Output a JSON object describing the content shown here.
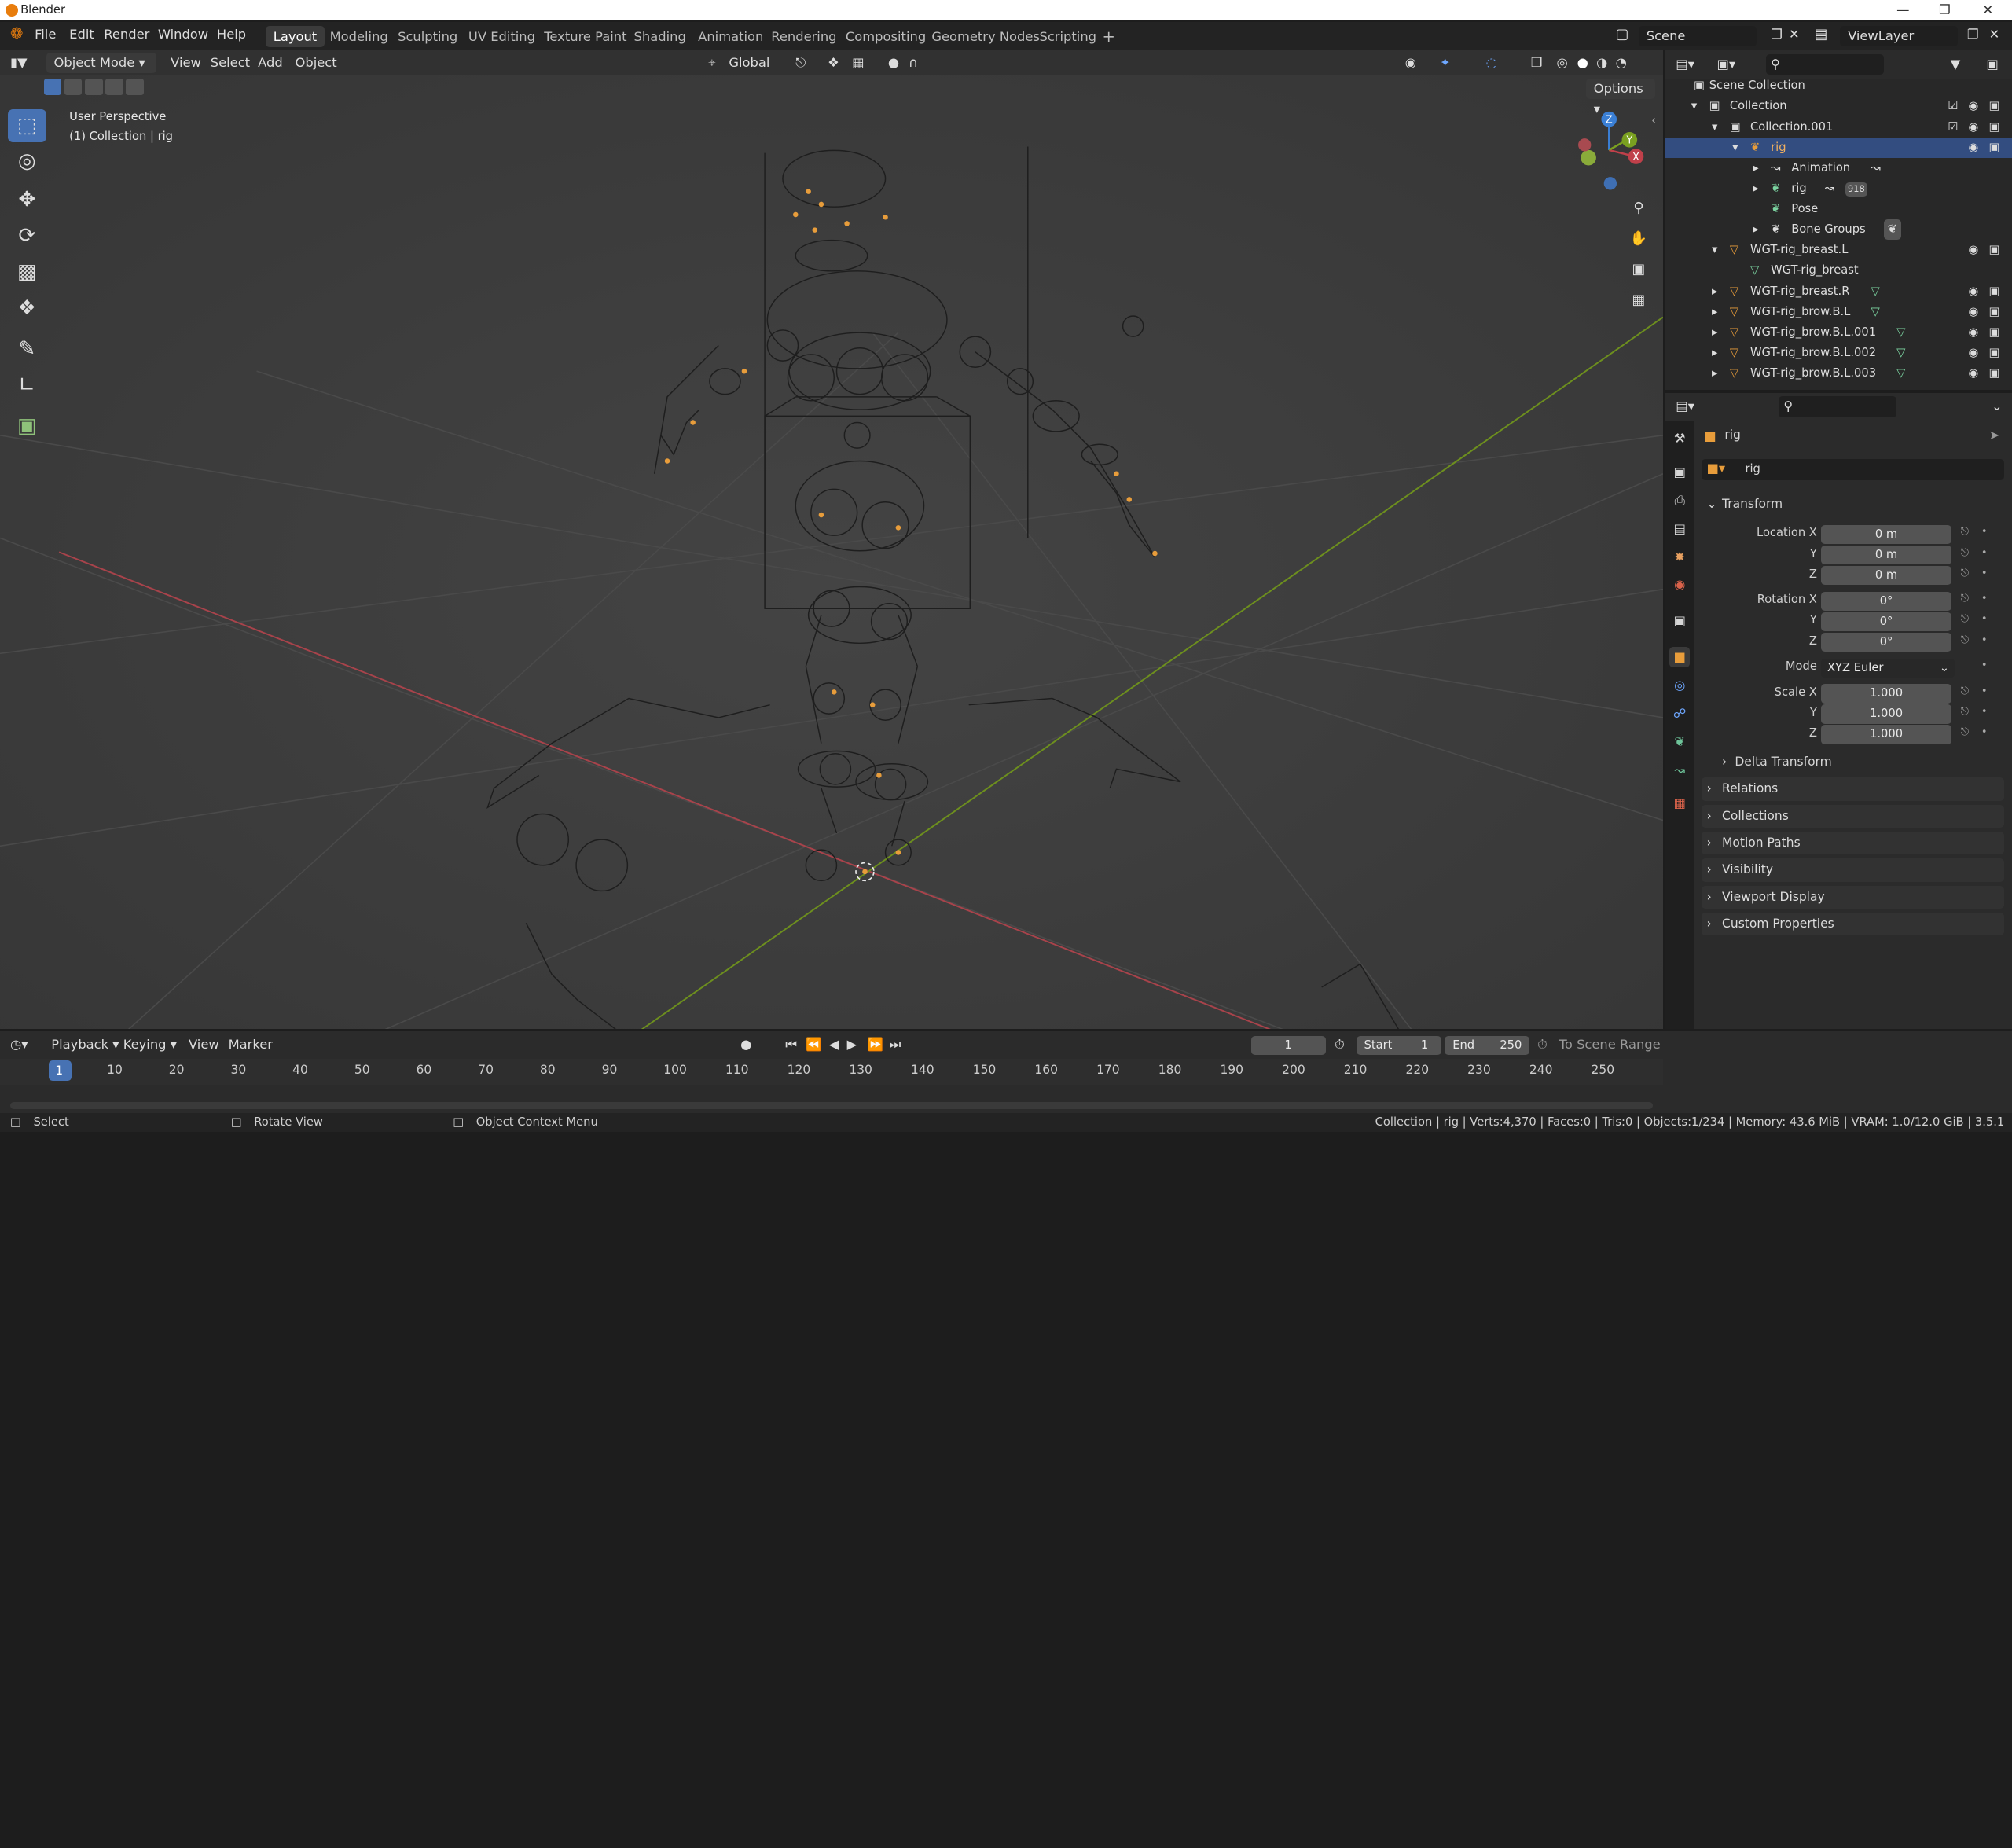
{
  "window": {
    "title": "Blender"
  },
  "menu": {
    "items": [
      "File",
      "Edit",
      "Render",
      "Window",
      "Help"
    ]
  },
  "workspaces": [
    "Layout",
    "Modeling",
    "Sculpting",
    "UV Editing",
    "Texture Paint",
    "Shading",
    "Animation",
    "Rendering",
    "Compositing",
    "Geometry Nodes",
    "Scripting"
  ],
  "active_workspace": "Layout",
  "scene": {
    "name": "Scene",
    "view_layer": "ViewLayer"
  },
  "viewport_header": {
    "mode": "Object Mode",
    "menus": [
      "View",
      "Select",
      "Add",
      "Object"
    ],
    "orientation": "Global",
    "options_label": "Options"
  },
  "viewport": {
    "perspective_label": "User Perspective",
    "collection_label": "(1) Collection | rig",
    "axis_x": "X",
    "axis_y": "Y",
    "axis_z": "Z",
    "colors": {
      "x_axis": "#c0404a",
      "y_axis": "#7aa020",
      "z_axis": "#3a7fd5",
      "selected": "#e89d3b"
    }
  },
  "outliner": {
    "search_placeholder": "",
    "rows": [
      {
        "label": "Scene Collection",
        "selected": false
      },
      {
        "label": "Collection",
        "selected": false
      },
      {
        "label": "Collection.001",
        "selected": false
      },
      {
        "label": "rig",
        "selected": true
      },
      {
        "label": "Animation",
        "selected": false
      },
      {
        "label": "rig",
        "selected": false,
        "badge": "918"
      },
      {
        "label": "Pose",
        "selected": false
      },
      {
        "label": "Bone Groups",
        "selected": false
      },
      {
        "label": "WGT-rig_breast.L",
        "selected": false
      },
      {
        "label": "WGT-rig_breast",
        "selected": false
      },
      {
        "label": "WGT-rig_breast.R",
        "selected": false
      },
      {
        "label": "WGT-rig_brow.B.L",
        "selected": false
      },
      {
        "label": "WGT-rig_brow.B.L.001",
        "selected": false
      },
      {
        "label": "WGT-rig_brow.B.L.002",
        "selected": false
      },
      {
        "label": "WGT-rig_brow.B.L.003",
        "selected": false
      }
    ]
  },
  "properties": {
    "object_name": "rig",
    "data_name": "rig",
    "transform_label": "Transform",
    "location_label": "Location X",
    "rotation_label": "Rotation X",
    "scale_label": "Scale X",
    "mode_label": "Mode",
    "y_label": "Y",
    "z_label": "Z",
    "location": [
      "0 m",
      "0 m",
      "0 m"
    ],
    "rotation": [
      "0°",
      "0°",
      "0°"
    ],
    "mode": "XYZ Euler",
    "scale": [
      "1.000",
      "1.000",
      "1.000"
    ],
    "panels": [
      "Delta Transform",
      "Relations",
      "Collections",
      "Motion Paths",
      "Visibility",
      "Viewport Display",
      "Custom Properties"
    ]
  },
  "timeline": {
    "menus": [
      "Playback",
      "Keying",
      "View",
      "Marker"
    ],
    "current_frame": "1",
    "start_label": "Start",
    "start": "1",
    "end_label": "End",
    "end": "250",
    "range_label": "To Scene Range",
    "ticks": [
      "1",
      "10",
      "20",
      "30",
      "40",
      "50",
      "60",
      "70",
      "80",
      "90",
      "100",
      "110",
      "120",
      "130",
      "140",
      "150",
      "160",
      "170",
      "180",
      "190",
      "200",
      "210",
      "220",
      "230",
      "240",
      "250"
    ]
  },
  "statusbar": {
    "select": "Select",
    "rotate": "Rotate View",
    "context": "Object Context Menu",
    "stats": "Collection | rig | Verts:4,370 | Faces:0 | Tris:0 | Objects:1/234 | Memory: 43.6 MiB | VRAM: 1.0/12.0 GiB | 3.5.1"
  }
}
